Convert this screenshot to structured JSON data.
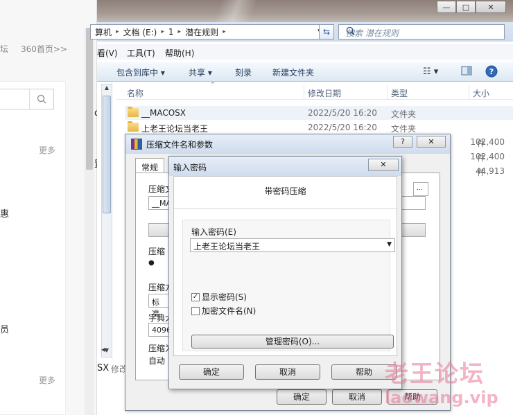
{
  "browser": {
    "nav_left": "坛",
    "nav_right": "360首页>>",
    "more_top": "更多",
    "more_bottom": "更多",
    "side_chars": [
      "d",
      "≡",
      "置"
    ],
    "left_chars": [
      "惠",
      "员"
    ]
  },
  "explorer": {
    "window_buttons": {
      "minimize": "—",
      "maximize": "□",
      "close": "✕"
    },
    "address": {
      "parts": [
        "算机",
        "文档 (E:)",
        "1",
        "潜在规则"
      ],
      "separator": "▸"
    },
    "search_placeholder": "搜索 潜在规则",
    "menu": [
      "看(V)",
      "工具(T)",
      "帮助(H)"
    ],
    "toolbar": [
      "包含到库中 ▾",
      "共享 ▾",
      "刻录",
      "新建文件夹"
    ],
    "columns": {
      "name": "名称",
      "date": "修改日期",
      "type": "类型",
      "size": "大小"
    },
    "files": [
      {
        "name": "__MACOSX",
        "date": "2022/5/20 16:20",
        "type": "文件夹",
        "size": ""
      },
      {
        "name": "上老王论坛当老王",
        "date": "2022/5/20 16:20",
        "type": "文件夹",
        "size": ""
      },
      {
        "name": "",
        "date": "",
        "type": "件",
        "size": "102,400"
      },
      {
        "name": "",
        "date": "",
        "type": "件",
        "size": "102,400"
      },
      {
        "name": "",
        "date": "",
        "type": "件",
        "size": "44,913"
      }
    ],
    "status": {
      "left": "SX",
      "right": "修改"
    }
  },
  "dialog_main": {
    "title": "压缩文件名和参数",
    "help_btn": "?",
    "close_btn": "✕",
    "tabs": [
      "常规"
    ],
    "fields": {
      "archive_label": "压缩文",
      "archive_value": "__MAC",
      "browse_btn": "...",
      "format_label": "压缩",
      "format_value": "●",
      "method_label": "压缩方",
      "method_value": "标准",
      "dict_label": "字典大",
      "dict_value": "4096",
      "split_label": "压缩为",
      "split_value": "自动"
    },
    "buttons": {
      "ok": "确定",
      "cancel": "取消",
      "help": "帮助"
    }
  },
  "dialog_password": {
    "title": "输入密码",
    "close_btn": "✕",
    "header": "带密码压缩",
    "password_label": "输入密码(E)",
    "password_value": "上老王论坛当老王",
    "show_password": "显示密码(S)",
    "encrypt_names": "加密文件名(N)",
    "show_password_checked": true,
    "encrypt_names_checked": false,
    "manage_btn": "管理密码(O)...",
    "buttons": {
      "ok": "确定",
      "cancel": "取消",
      "help": "帮助"
    }
  },
  "watermark": {
    "line1": "老王论坛",
    "line2": "laowang.vip"
  }
}
